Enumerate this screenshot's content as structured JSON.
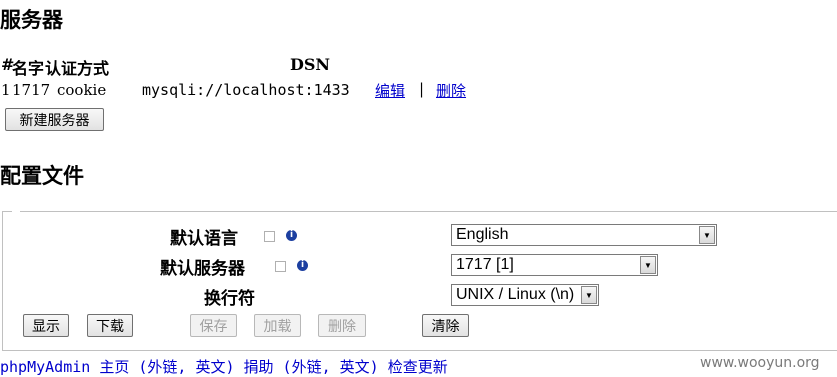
{
  "servers": {
    "title": "服务器",
    "headers": [
      "#",
      "名字",
      "认证方式",
      "DSN"
    ],
    "rows": [
      {
        "id": "1",
        "name": "1717",
        "auth": "cookie",
        "dsn": "mysqli://localhost:1433",
        "edit": "编辑",
        "sep": "|",
        "delete": "删除"
      }
    ],
    "new_button": "新建服务器"
  },
  "config": {
    "title": "配置文件",
    "rows": [
      {
        "label": "默认语言",
        "value": "English"
      },
      {
        "label": "默认服务器",
        "value": "1717 [1]"
      },
      {
        "label": "换行符",
        "value": "UNIX / Linux (\\n)"
      }
    ],
    "buttons": {
      "show": "显示",
      "download": "下载",
      "save": "保存",
      "load": "加载",
      "delete": "删除",
      "clear": "清除"
    }
  },
  "footer": {
    "text": "phpMyAdmin 主页 (外链, 英文) 捐助 (外链, 英文) 检查更新"
  },
  "watermark": "www.wooyun.org"
}
